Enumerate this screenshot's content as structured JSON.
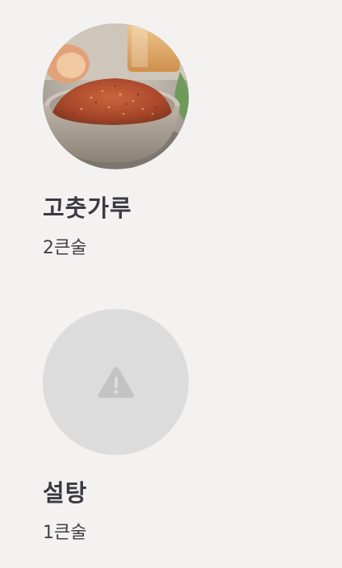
{
  "ingredients": [
    {
      "name": "고춧가루",
      "amount": "2큰술",
      "image": "chili-powder-photo"
    },
    {
      "name": "설탕",
      "amount": "1큰술",
      "image": "warning-icon"
    }
  ],
  "colors": {
    "background": "#f4f2f1",
    "title": "#3a3a44",
    "placeholder": "#dcdcdc",
    "placeholder_icon": "#c3c3c3"
  }
}
